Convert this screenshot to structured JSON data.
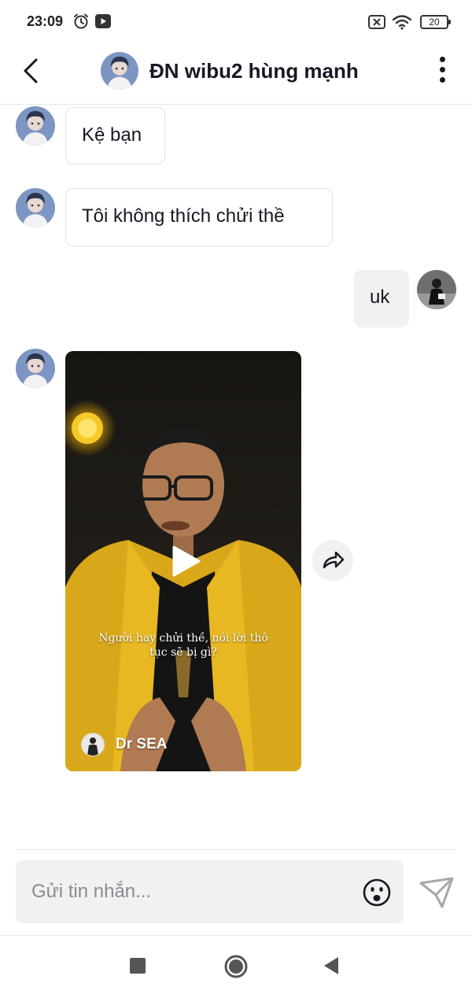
{
  "status_bar": {
    "time": "23:09",
    "battery": "20",
    "icons": [
      "alarm-icon",
      "video-app-icon",
      "sim-disabled-icon",
      "wifi-icon",
      "battery-icon"
    ]
  },
  "header": {
    "title": "ĐN wibu2 hùng mạnh",
    "back_icon": "chevron-left-icon",
    "more_icon": "more-vertical-icon"
  },
  "messages": [
    {
      "sender": "other",
      "text": "Kệ bạn"
    },
    {
      "sender": "other",
      "text": "Tôi không thích chửi thề"
    },
    {
      "sender": "me",
      "text": "uk"
    },
    {
      "sender": "other",
      "type": "video",
      "caption": "Người hay chửi thề, nói lời thô tục sẽ bị gì?",
      "author": "Dr SEA"
    }
  ],
  "composer": {
    "placeholder": "Gửi tin nhắn...",
    "emoji_icon": "emoji-icon",
    "send_icon": "send-icon"
  },
  "nav_bar": {
    "icons": [
      "recent-apps-icon",
      "home-icon",
      "back-triangle-icon"
    ]
  },
  "colors": {
    "bubble_incoming_bg": "#ffffff",
    "bubble_incoming_border": "#e3e3e4",
    "bubble_outgoing_bg": "#f1f1f2",
    "text_primary": "#161823",
    "placeholder": "#8a8b91",
    "send_icon": "#a6a7ab"
  }
}
